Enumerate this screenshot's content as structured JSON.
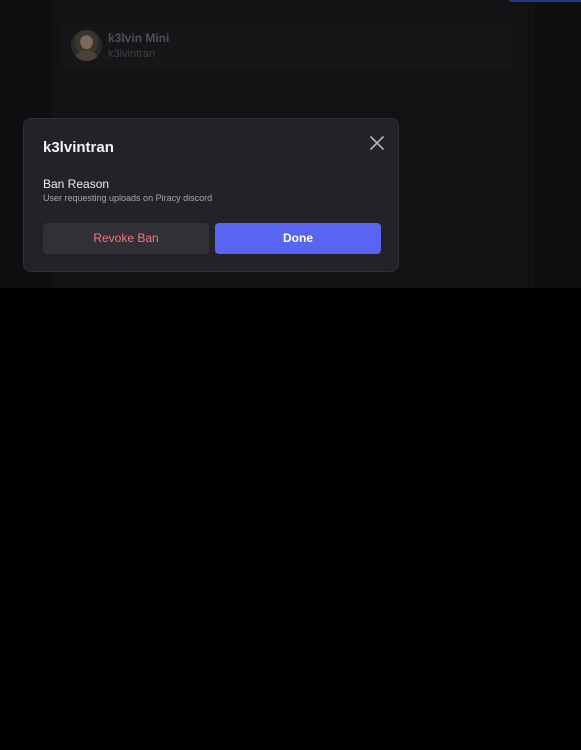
{
  "background_panel": {
    "banned_user": {
      "display_name": "k3lvin Mini",
      "username": "k3lvintran"
    }
  },
  "modal": {
    "title": "k3lvintran",
    "reason_heading": "Ban Reason",
    "reason_text": "User requesting uploads on Piracy discord",
    "revoke_label": "Revoke Ban",
    "done_label": "Done",
    "close_icon": "close-icon"
  },
  "colors": {
    "accent": "#5865f2",
    "danger_text": "#f0797a",
    "modal_bg": "#232327"
  }
}
